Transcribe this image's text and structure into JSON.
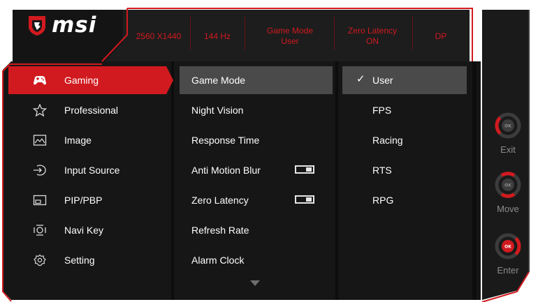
{
  "brand": {
    "logo_text": "msi",
    "accent": "#d11a1f"
  },
  "status_bar": {
    "resolution": "2560 X1440",
    "refresh": "144 Hz",
    "mode_line1": "Game Mode",
    "mode_line2": "User",
    "latency_line1": "Zero Latency",
    "latency_line2": "ON",
    "input": "DP"
  },
  "main_menu": [
    {
      "label": "Gaming",
      "icon": "gamepad-icon",
      "active": true
    },
    {
      "label": "Professional",
      "icon": "star-icon"
    },
    {
      "label": "Image",
      "icon": "image-icon"
    },
    {
      "label": "Input Source",
      "icon": "input-source-icon"
    },
    {
      "label": "PIP/PBP",
      "icon": "pip-icon"
    },
    {
      "label": "Navi Key",
      "icon": "navi-key-icon"
    },
    {
      "label": "Setting",
      "icon": "gear-icon"
    }
  ],
  "gaming_menu": [
    {
      "label": "Game Mode",
      "selected": true
    },
    {
      "label": "Night Vision"
    },
    {
      "label": "Response Time"
    },
    {
      "label": "Anti Motion Blur",
      "toggle": true
    },
    {
      "label": "Zero Latency",
      "toggle": true
    },
    {
      "label": "Refresh Rate"
    },
    {
      "label": "Alarm Clock"
    }
  ],
  "game_mode_options": [
    {
      "label": "User",
      "checked": true,
      "check_mark": "✓"
    },
    {
      "label": "FPS"
    },
    {
      "label": "Racing"
    },
    {
      "label": "RTS"
    },
    {
      "label": "RPG"
    }
  ],
  "navi_hints": {
    "exit": "Exit",
    "move": "Move",
    "enter": "Enter",
    "ok_text": "OK"
  }
}
